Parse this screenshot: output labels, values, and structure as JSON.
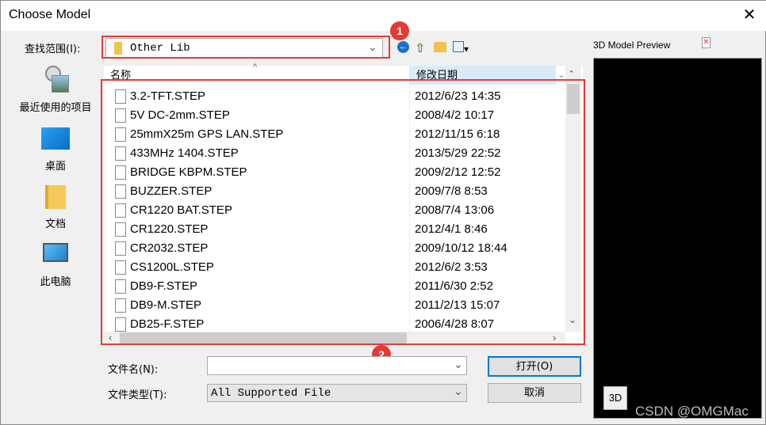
{
  "window": {
    "title": "Choose Model",
    "close_label": "✕"
  },
  "lookin": {
    "label": "查找范围(I):",
    "value": "Other Lib"
  },
  "badges": [
    "1",
    "2"
  ],
  "toolbar": {
    "icons": [
      "back-icon",
      "up-folder-icon",
      "new-folder-icon",
      "view-menu-icon"
    ]
  },
  "preview": {
    "title": "3D Model Preview",
    "button_3d": "3D",
    "watermark": "CSDN @OMGMac"
  },
  "places": [
    {
      "label": "最近使用的项目",
      "icon": "recent-icon"
    },
    {
      "label": "桌面",
      "icon": "desktop-icon"
    },
    {
      "label": "文档",
      "icon": "documents-icon"
    },
    {
      "label": "此电脑",
      "icon": "computer-icon"
    }
  ],
  "list": {
    "columns": [
      "名称",
      "修改日期"
    ],
    "rows": [
      {
        "name": "3.2-TFT.STEP",
        "date": "2012/6/23 14:35"
      },
      {
        "name": "5V DC-2mm.STEP",
        "date": "2008/4/2 10:17"
      },
      {
        "name": "25mmX25m GPS LAN.STEP",
        "date": "2012/11/15 6:18"
      },
      {
        "name": "433MHz 1404.STEP",
        "date": "2013/5/29 22:52"
      },
      {
        "name": "BRIDGE KBPM.STEP",
        "date": "2009/2/12 12:52"
      },
      {
        "name": "BUZZER.STEP",
        "date": "2009/7/8 8:53"
      },
      {
        "name": "CR1220 BAT.STEP",
        "date": "2008/7/4 13:06"
      },
      {
        "name": "CR1220.STEP",
        "date": "2012/4/1 8:46"
      },
      {
        "name": "CR2032.STEP",
        "date": "2009/10/12 18:44"
      },
      {
        "name": "CS1200L.STEP",
        "date": "2012/6/2 3:53"
      },
      {
        "name": "DB9-F.STEP",
        "date": "2011/6/30 2:52"
      },
      {
        "name": "DB9-M.STEP",
        "date": "2011/2/13 15:07"
      },
      {
        "name": "DB25-F.STEP",
        "date": "2006/4/28 8:07"
      }
    ]
  },
  "filename": {
    "label": "文件名(N):",
    "value": ""
  },
  "filetype": {
    "label": "文件类型(T):",
    "value": "All Supported File"
  },
  "buttons": {
    "open": "打开(O)",
    "cancel": "取消"
  },
  "colors": {
    "annotation_red": "#e53935",
    "focus_blue": "#0078d7"
  }
}
